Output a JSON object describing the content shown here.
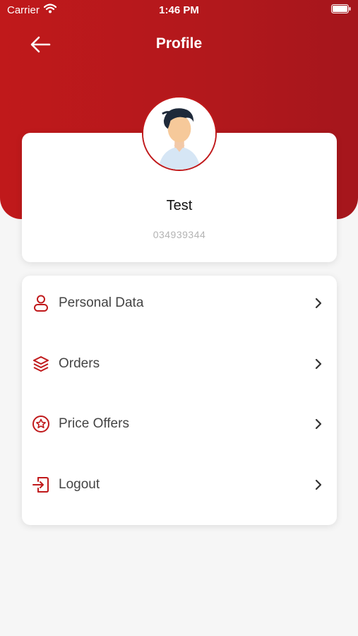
{
  "status_bar": {
    "carrier": "Carrier",
    "time": "1:46 PM"
  },
  "header": {
    "title": "Profile"
  },
  "profile": {
    "name": "Test",
    "phone": "034939344"
  },
  "menu": {
    "items": [
      {
        "label": "Personal Data",
        "icon": "user-icon"
      },
      {
        "label": "Orders",
        "icon": "layers-icon"
      },
      {
        "label": "Price Offers",
        "icon": "star-badge-icon"
      },
      {
        "label": "Logout",
        "icon": "logout-icon"
      }
    ]
  },
  "colors": {
    "brand": "#c0191b",
    "background": "#f6f6f6",
    "card": "#ffffff"
  }
}
